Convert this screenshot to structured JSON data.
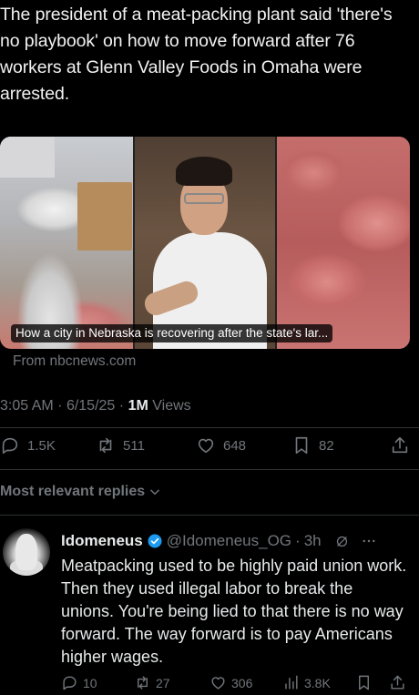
{
  "tweet": {
    "text": "The president of a meat-packing plant said 'there's no playbook' on how to move forward after 76 workers at Glenn Valley Foods in Omaha were arrested.",
    "card_caption": "How a city in Nebraska is recovering after the state's lar...",
    "source": "From nbcnews.com",
    "time": "3:05 AM",
    "date": "6/15/25",
    "views_count": "1M",
    "views_label": "Views",
    "replies": "1.5K",
    "reposts": "511",
    "likes": "648",
    "bookmarks": "82"
  },
  "replies_filter": "Most relevant replies",
  "reply": {
    "name": "Idomeneus",
    "handle": "@Idomeneus_OG",
    "age": "3h",
    "text": "Meatpacking used to be highly paid union work.  Then they used illegal labor to break the unions.  You're being lied to that there is no way forward.  The way forward is to pay Americans higher wages.",
    "replies": "10",
    "reposts": "27",
    "likes": "306",
    "views": "3.8K"
  },
  "colors": {
    "background": "#000000",
    "text": "#e7e9ea",
    "muted": "#71767b",
    "verified": "#1d9bf0"
  },
  "icons": [
    "reply-icon",
    "repost-icon",
    "like-icon",
    "bookmark-icon",
    "share-icon",
    "chevron-down-icon",
    "verified-badge-icon",
    "grok-icon",
    "more-icon",
    "views-icon"
  ]
}
